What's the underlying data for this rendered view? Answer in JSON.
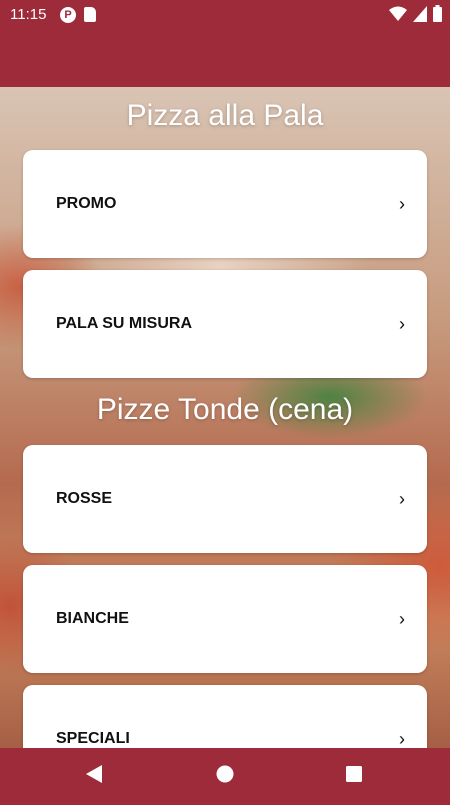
{
  "status_bar": {
    "time": "11:15",
    "app_icon_letter": "P"
  },
  "colors": {
    "brand": "#9e2b3a",
    "card": "#ffffff",
    "title": "#ffffff"
  },
  "sections": [
    {
      "title": "Pizza alla Pala",
      "items": [
        {
          "label": "PROMO",
          "chevron": "›"
        },
        {
          "label": "PALA SU MISURA",
          "chevron": "›"
        }
      ]
    },
    {
      "title": "Pizze Tonde (cena)",
      "items": [
        {
          "label": "ROSSE",
          "chevron": "›"
        },
        {
          "label": "BIANCHE",
          "chevron": "›"
        },
        {
          "label": "SPECIALI",
          "chevron": "›"
        }
      ]
    }
  ],
  "nav": {
    "back_icon": "back-triangle",
    "home_icon": "home-circle",
    "recents_icon": "recents-square"
  }
}
